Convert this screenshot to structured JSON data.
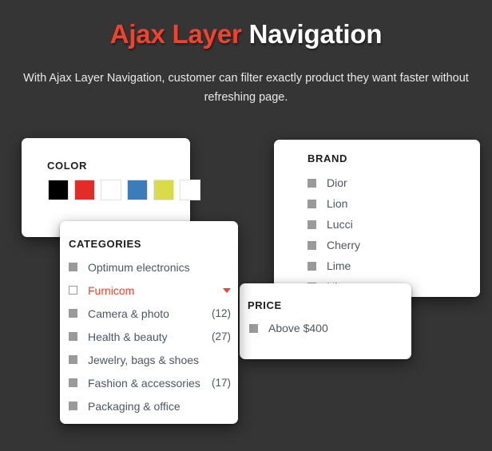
{
  "header": {
    "title_accent": "Ajax Layer",
    "title_rest": " Navigation",
    "subtitle": "With Ajax Layer Navigation, customer can filter exactly product they want faster without refreshing page.",
    "accent_color": "#f4412b",
    "background_color": "#353535"
  },
  "panels": {
    "color": {
      "title": "COLOR",
      "swatches": [
        {
          "name": "black",
          "hex": "#000000"
        },
        {
          "name": "red",
          "hex": "#e32b28"
        },
        {
          "name": "white",
          "hex": "#ffffff"
        },
        {
          "name": "blue",
          "hex": "#3b7cba"
        },
        {
          "name": "yellow",
          "hex": "#dadb4a"
        },
        {
          "name": "white2",
          "hex": "#ffffff"
        }
      ]
    },
    "brand": {
      "title": "BRAND",
      "items": [
        {
          "label": "Dior",
          "checkbox": "filled",
          "count": ""
        },
        {
          "label": "Lion",
          "checkbox": "filled",
          "count": ""
        },
        {
          "label": "Lucci",
          "checkbox": "filled",
          "count": ""
        },
        {
          "label": "Cherry",
          "checkbox": "filled",
          "count": ""
        },
        {
          "label": "Lime",
          "checkbox": "filled",
          "count": ""
        },
        {
          "label": "Nice",
          "checkbox": "filled",
          "count": ""
        }
      ]
    },
    "categories": {
      "title": "CATEGORIES",
      "items": [
        {
          "label": "Optimum electronics",
          "checkbox": "filled",
          "count": "",
          "active": false,
          "caret": false
        },
        {
          "label": "Furnicom",
          "checkbox": "outline",
          "count": "",
          "active": true,
          "caret": true
        },
        {
          "label": "Camera & photo",
          "checkbox": "filled",
          "count": "(12)",
          "active": false,
          "caret": false
        },
        {
          "label": "Health & beauty",
          "checkbox": "filled",
          "count": "(27)",
          "active": false,
          "caret": false
        },
        {
          "label": "Jewelry, bags & shoes",
          "checkbox": "filled",
          "count": "",
          "active": false,
          "caret": false
        },
        {
          "label": "Fashion & accessories",
          "checkbox": "filled",
          "count": "(17)",
          "active": false,
          "caret": false
        },
        {
          "label": "Packaging & office",
          "checkbox": "filled",
          "count": "",
          "active": false,
          "caret": false
        }
      ]
    },
    "price": {
      "title": "PRICE",
      "items": [
        {
          "label": "Above $400",
          "checkbox": "filled",
          "count": ""
        }
      ]
    }
  }
}
